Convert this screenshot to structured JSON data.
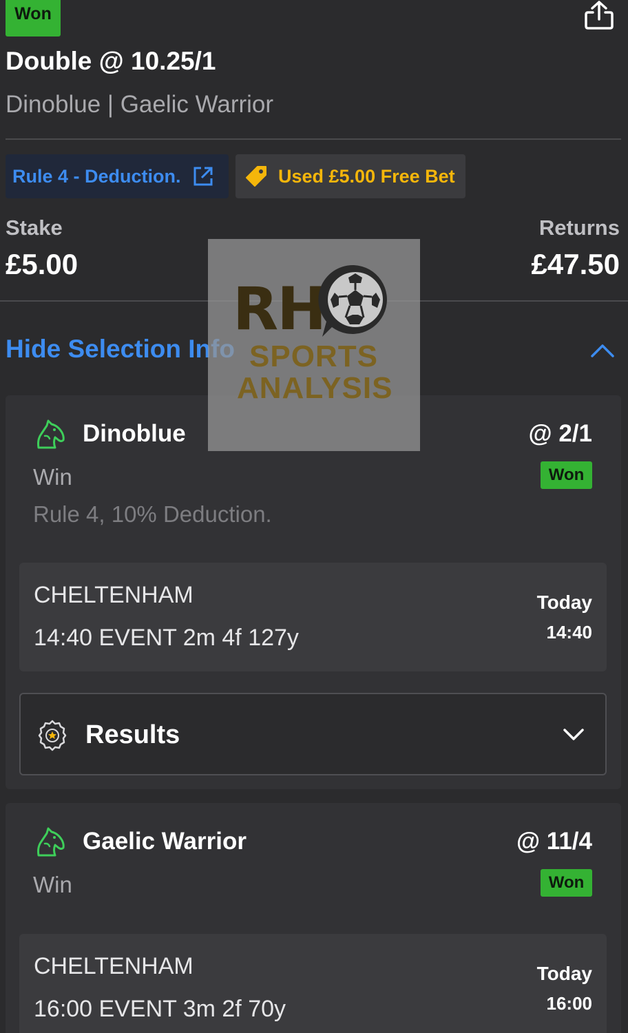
{
  "status_badge": "Won",
  "bet": {
    "title": "Double @ 10.25/1",
    "selections_summary": "Dinoblue | Gaelic Warrior"
  },
  "tags": {
    "rule4": "Rule 4 - Deduction.",
    "free_bet": "Used £5.00 Free Bet"
  },
  "stake": {
    "label": "Stake",
    "value": "£5.00"
  },
  "returns": {
    "label": "Returns",
    "value": "£47.50"
  },
  "toggle_label": "Hide Selection Info",
  "selections": [
    {
      "name": "Dinoblue",
      "odds": "@ 2/1",
      "status": "Won",
      "market": "Win",
      "note": "Rule 4, 10% Deduction.",
      "venue": "CHELTENHAM",
      "event": "14:40 EVENT 2m 4f 127y",
      "day": "Today",
      "time": "14:40",
      "results_label": "Results"
    },
    {
      "name": "Gaelic Warrior",
      "odds": "@ 11/4",
      "status": "Won",
      "market": "Win",
      "venue": "CHELTENHAM",
      "event": "16:00 EVENT 3m 2f 70y",
      "day": "Today",
      "time": "16:00"
    }
  ],
  "watermark": {
    "line1": "RH",
    "line2": "SPORTS",
    "line3": "ANALYSIS"
  },
  "colors": {
    "background": "#2b2b2d",
    "card": "#323235",
    "won_green": "#34b233",
    "link_blue": "#3d8cf0",
    "free_bet_gold": "#f5b60b",
    "horse_icon": "#3ecf5a"
  },
  "icons": [
    "share-icon",
    "external-link-icon",
    "tag-icon",
    "chevron-up-icon",
    "horse-icon",
    "award-rosette-icon",
    "chevron-down-icon"
  ]
}
